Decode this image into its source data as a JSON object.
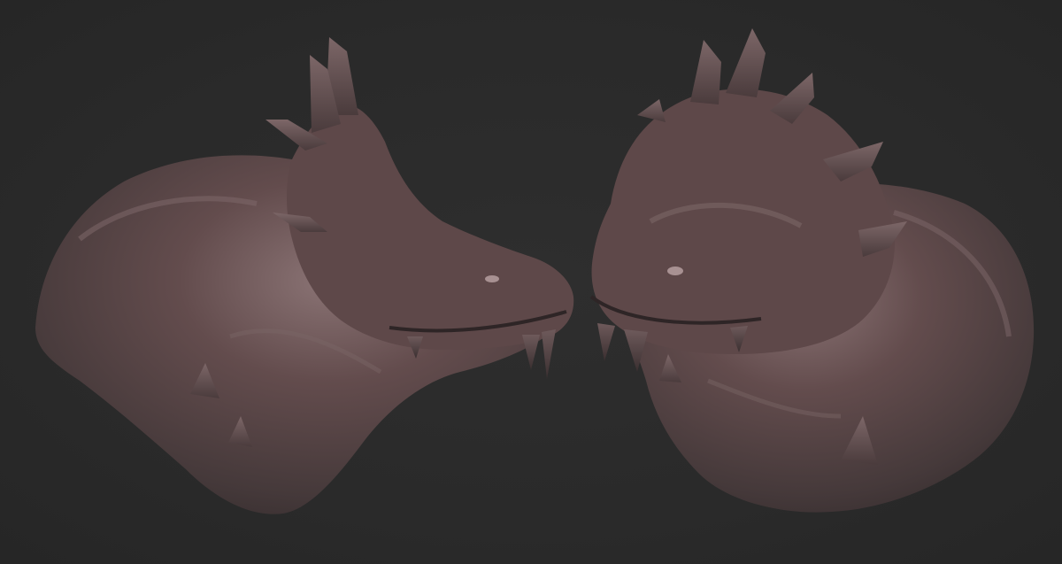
{
  "scene": {
    "background_color": "#2b2b2b",
    "material_color": "#5a4647",
    "subjects": [
      {
        "name": "creature-bust-profile-view"
      },
      {
        "name": "creature-bust-three-quarter-view"
      }
    ]
  }
}
